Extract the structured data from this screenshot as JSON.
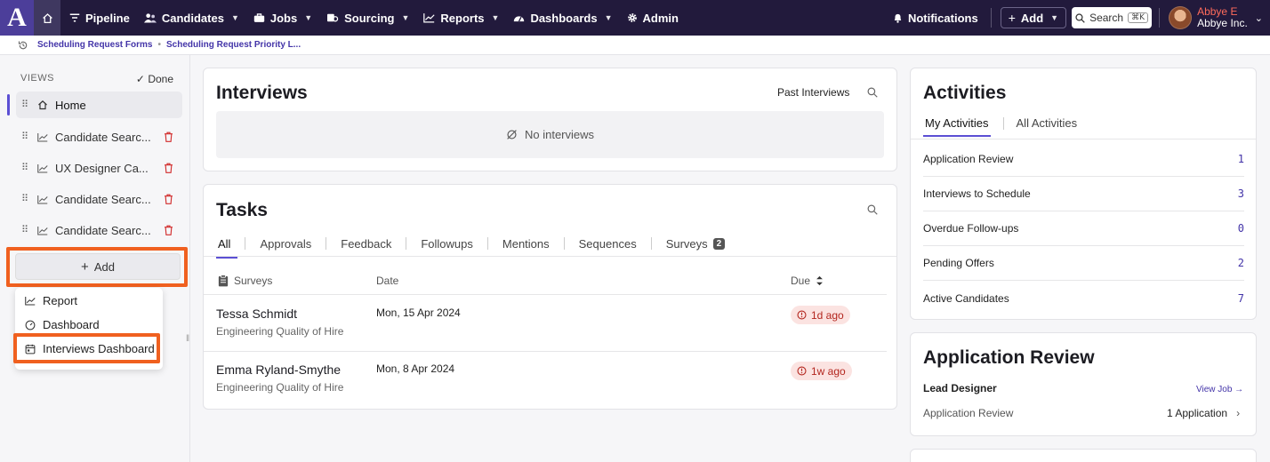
{
  "app": {
    "logo_letter": "A"
  },
  "nav": {
    "items": [
      {
        "label": "Pipeline",
        "icon": "filter-icon"
      },
      {
        "label": "Candidates",
        "icon": "people-icon"
      },
      {
        "label": "Jobs",
        "icon": "briefcase-icon"
      },
      {
        "label": "Sourcing",
        "icon": "sourcing-icon"
      },
      {
        "label": "Reports",
        "icon": "chart-icon"
      },
      {
        "label": "Dashboards",
        "icon": "gauge-icon"
      },
      {
        "label": "Admin",
        "icon": "gear-icon"
      }
    ],
    "notifications": "Notifications",
    "add": "Add",
    "search": "Search",
    "search_shortcut": "⌘K",
    "user_name": "Abbye E",
    "user_org": "Abbye Inc."
  },
  "breadcrumb": {
    "items": [
      "Scheduling Request Forms",
      "Scheduling Request Priority L..."
    ]
  },
  "sidebar": {
    "header": "VIEWS",
    "done": "Done",
    "items": [
      {
        "label": "Home"
      },
      {
        "label": "Candidate Searc..."
      },
      {
        "label": "UX Designer Ca..."
      },
      {
        "label": "Candidate Searc..."
      },
      {
        "label": "Candidate Searc..."
      }
    ],
    "add": "Add",
    "menu": [
      {
        "label": "Report"
      },
      {
        "label": "Dashboard"
      },
      {
        "label": "Interviews Dashboard"
      }
    ]
  },
  "interviews": {
    "title": "Interviews",
    "past_link": "Past Interviews",
    "empty": "No interviews"
  },
  "tasks": {
    "title": "Tasks",
    "tabs": [
      "All",
      "Approvals",
      "Feedback",
      "Followups",
      "Mentions",
      "Sequences",
      "Surveys"
    ],
    "surveys_badge": "2",
    "columns": [
      "Surveys",
      "Date",
      "Due"
    ],
    "rows": [
      {
        "name": "Tessa Schmidt",
        "sub": "Engineering Quality of Hire",
        "date": "Mon, 15 Apr 2024",
        "due": "1d ago"
      },
      {
        "name": "Emma Ryland-Smythe",
        "sub": "Engineering Quality of Hire",
        "date": "Mon, 8 Apr 2024",
        "due": "1w ago"
      }
    ]
  },
  "activities": {
    "title": "Activities",
    "tabs": [
      "My Activities",
      "All Activities"
    ],
    "rows": [
      {
        "label": "Application Review",
        "count": "1"
      },
      {
        "label": "Interviews to Schedule",
        "count": "3"
      },
      {
        "label": "Overdue Follow-ups",
        "count": "0"
      },
      {
        "label": "Pending Offers",
        "count": "2"
      },
      {
        "label": "Active Candidates",
        "count": "7"
      }
    ]
  },
  "app_review": {
    "title": "Application Review",
    "job": "Lead Designer",
    "view_job": "View Job →",
    "stage": "Application Review",
    "count": "1 Application"
  },
  "colors": {
    "nav_bg": "#221a3c",
    "accent": "#5b4fd4",
    "highlight": "#f0601f",
    "link": "#4334a8"
  }
}
